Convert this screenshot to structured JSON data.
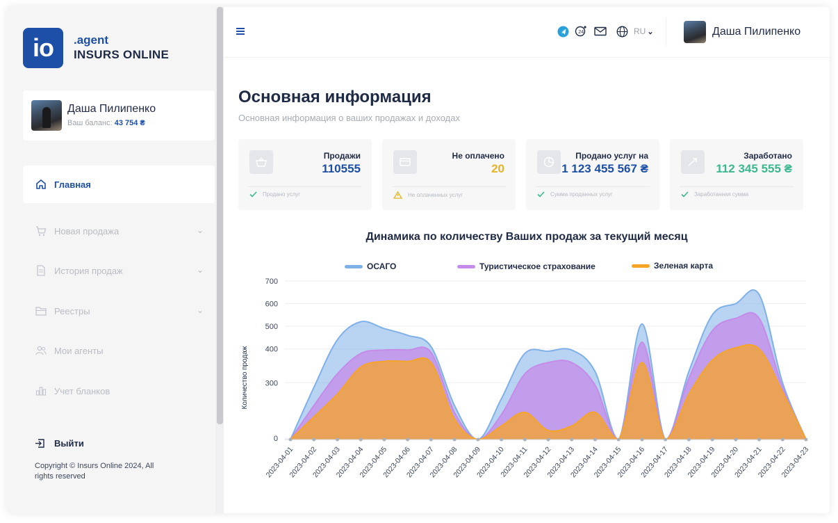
{
  "app": {
    "logo_mark": "io",
    "logo_agent": ".agent",
    "logo_company": "INSURS ONLINE"
  },
  "profile": {
    "name": "Даша Пилипенко",
    "balance_label": "Ваш баланс:",
    "balance_value": "43 754 ₴"
  },
  "sidebar": {
    "items": [
      {
        "label": "Главная",
        "icon": "home-icon",
        "active": true
      },
      {
        "label": "Новая продажа",
        "icon": "cart-icon",
        "chevron": true
      },
      {
        "label": "История продаж",
        "icon": "document-icon",
        "chevron": true
      },
      {
        "label": "Реестры",
        "icon": "folder-icon",
        "chevron": true
      },
      {
        "label": "Мои агенты",
        "icon": "users-icon"
      },
      {
        "label": "Учет бланков",
        "icon": "bar-chart-icon"
      }
    ],
    "logout": "Выйти",
    "copyright": "Copyright © Insurs Online 2024, All rights reserved"
  },
  "topbar": {
    "language": "RU",
    "user_name": "Даша Пилипенко"
  },
  "page": {
    "title": "Основная информация",
    "subtitle": "Основная информация о ваших продажах и доходах"
  },
  "stats": [
    {
      "label": "Продажи",
      "value": "110555",
      "foot": "Продано услуг",
      "color": "#1d4fa6",
      "foot_icon": "check-icon"
    },
    {
      "label": "Не оплачено",
      "value": "20",
      "foot": "Не оплаченных услуг",
      "color": "#e6b422",
      "foot_icon": "warning-icon"
    },
    {
      "label": "Продано услуг на",
      "value": "1 123 455 567 ₴",
      "foot": "Сумма проданных услуг",
      "color": "#1d4fa6",
      "foot_icon": "check-icon"
    },
    {
      "label": "Заработано",
      "value": "112 345 555 ₴",
      "foot": "Заработанная сумма",
      "color": "#3bb88f",
      "foot_icon": "check-icon"
    }
  ],
  "chart_data": {
    "type": "area",
    "title": "Динамика по количеству Ваших продаж за текущий месяц",
    "ylabel": "Количество продаж",
    "xlabel": "",
    "ylim": [
      0,
      700
    ],
    "yticks": [
      0,
      300,
      400,
      500,
      600,
      700
    ],
    "legend_position": "top",
    "categories": [
      "2023-04-01",
      "2023-04-02",
      "2023-04-03",
      "2023-04-04",
      "2023-04-05",
      "2023-04-06",
      "2023-04-07",
      "2023-04-08",
      "2023-04-09",
      "2023-04-10",
      "2023-04-11",
      "2023-04-12",
      "2023-04-13",
      "2023-04-14",
      "2023-04-15",
      "2023-04-16",
      "2023-04-17",
      "2023-04-18",
      "2023-04-19",
      "2023-04-20",
      "2023-04-21",
      "2023-04-22",
      "2023-04-23"
    ],
    "series": [
      {
        "name": "ОСАГО",
        "color": "#7fb0e8",
        "values": [
          0,
          230,
          440,
          520,
          490,
          460,
          410,
          150,
          0,
          180,
          380,
          390,
          395,
          300,
          0,
          510,
          0,
          300,
          550,
          600,
          640,
          250,
          0
        ]
      },
      {
        "name": "Туристическое страхование",
        "color": "#c58be8",
        "values": [
          0,
          150,
          290,
          380,
          395,
          395,
          385,
          120,
          0,
          110,
          290,
          340,
          340,
          240,
          0,
          430,
          0,
          270,
          480,
          535,
          535,
          230,
          0
        ]
      },
      {
        "name": "Зеленая карта",
        "color": "#f5a425",
        "values": [
          0,
          100,
          200,
          320,
          345,
          345,
          340,
          90,
          0,
          60,
          120,
          40,
          60,
          120,
          0,
          340,
          0,
          200,
          350,
          405,
          400,
          210,
          0
        ]
      }
    ]
  }
}
